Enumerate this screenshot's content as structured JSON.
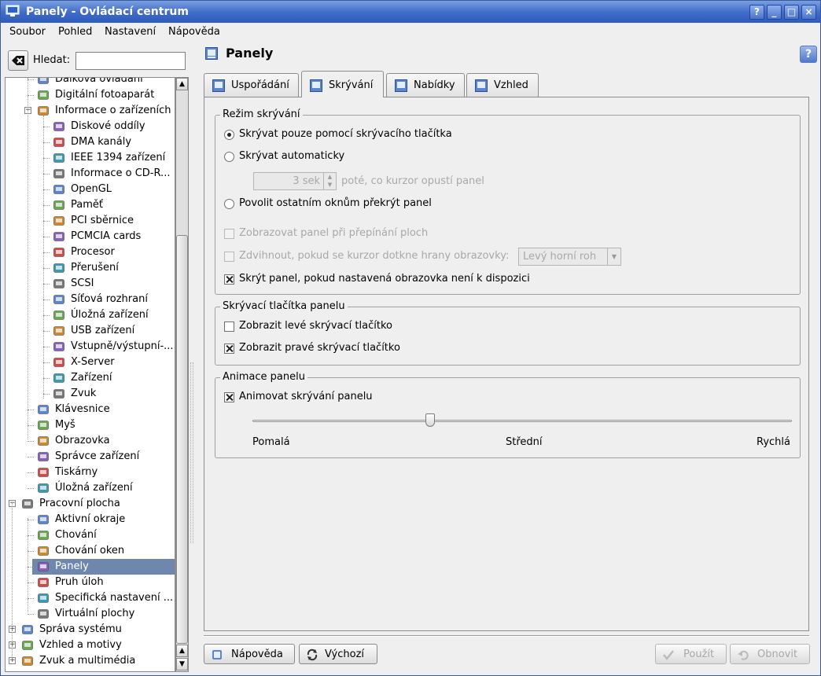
{
  "window": {
    "title": "Panely - Ovládací centrum",
    "buttons": {
      "help": "?",
      "minimize": "_",
      "maximize": "□",
      "close": "×"
    }
  },
  "menubar": [
    "Soubor",
    "Pohled",
    "Nastavení",
    "Nápověda"
  ],
  "search": {
    "label": "Hledat:",
    "value": ""
  },
  "tree": [
    {
      "label": "Dálková ovládání",
      "icon": "remote-icon",
      "level": 1
    },
    {
      "label": "Digitální fotoaparát",
      "icon": "camera-icon",
      "level": 1
    },
    {
      "label": "Informace o zařízeních",
      "icon": "info-icon",
      "level": 1,
      "expanded": true
    },
    {
      "label": "Diskové oddíly",
      "icon": "disk-icon",
      "level": 2
    },
    {
      "label": "DMA kanály",
      "icon": "dma-icon",
      "level": 2
    },
    {
      "label": "IEEE 1394 zařízení",
      "icon": "firewire-icon",
      "level": 2
    },
    {
      "label": "Informace o CD-R...",
      "icon": "cdrom-icon",
      "level": 2
    },
    {
      "label": "OpenGL",
      "icon": "opengl-icon",
      "level": 2
    },
    {
      "label": "Paměť",
      "icon": "memory-icon",
      "level": 2
    },
    {
      "label": "PCI sběrnice",
      "icon": "pci-icon",
      "level": 2
    },
    {
      "label": "PCMCIA cards",
      "icon": "pcmcia-icon",
      "level": 2
    },
    {
      "label": "Procesor",
      "icon": "cpu-icon",
      "level": 2
    },
    {
      "label": "Přerušení",
      "icon": "interrupt-icon",
      "level": 2
    },
    {
      "label": "SCSI",
      "icon": "scsi-icon",
      "level": 2
    },
    {
      "label": "Síťová rozhraní",
      "icon": "network-icon",
      "level": 2
    },
    {
      "label": "Úložná zařízení",
      "icon": "storage-icon",
      "level": 2
    },
    {
      "label": "USB zařízení",
      "icon": "usb-icon",
      "level": 2
    },
    {
      "label": "Vstupně/výstupní-...",
      "icon": "io-icon",
      "level": 2
    },
    {
      "label": "X-Server",
      "icon": "xserver-icon",
      "level": 2
    },
    {
      "label": "Zařízení",
      "icon": "device-icon",
      "level": 2
    },
    {
      "label": "Zvuk",
      "icon": "sound-icon",
      "level": 2
    },
    {
      "label": "Klávesnice",
      "icon": "keyboard-icon",
      "level": 1
    },
    {
      "label": "Myš",
      "icon": "mouse-icon",
      "level": 1
    },
    {
      "label": "Obrazovka",
      "icon": "display-icon",
      "level": 1
    },
    {
      "label": "Správce zařízení",
      "icon": "device-manager-icon",
      "level": 1
    },
    {
      "label": "Tiskárny",
      "icon": "printer-icon",
      "level": 1
    },
    {
      "label": "Úložná zařízení",
      "icon": "storage-icon",
      "level": 1
    },
    {
      "label": "Pracovní plocha",
      "icon": "desktop-icon",
      "level": 0,
      "expanded": true
    },
    {
      "label": "Aktivní okraje",
      "icon": "edges-icon",
      "level": 1
    },
    {
      "label": "Chování",
      "icon": "behavior-icon",
      "level": 1
    },
    {
      "label": "Chování oken",
      "icon": "window-behavior-icon",
      "level": 1
    },
    {
      "label": "Panely",
      "icon": "panel-icon",
      "level": 1,
      "selected": true
    },
    {
      "label": "Pruh úloh",
      "icon": "taskbar-icon",
      "level": 1
    },
    {
      "label": "Specifická nastavení ...",
      "icon": "window-specific-icon",
      "level": 1
    },
    {
      "label": "Virtuální plochy",
      "icon": "virtual-desktops-icon",
      "level": 1
    },
    {
      "label": "Správa systému",
      "icon": "system-admin-icon",
      "level": 0,
      "expanded": false
    },
    {
      "label": "Vzhled a motivy",
      "icon": "appearance-icon",
      "level": 0,
      "expanded": false
    },
    {
      "label": "Zvuk a multimédia",
      "icon": "multimedia-icon",
      "level": 0,
      "expanded": false
    }
  ],
  "page": {
    "title": "Panely"
  },
  "tabs": [
    {
      "label": "Uspořádání",
      "active": false
    },
    {
      "label": "Skrývání",
      "active": true
    },
    {
      "label": "Nabídky",
      "active": false
    },
    {
      "label": "Vzhled",
      "active": false
    }
  ],
  "hide_mode": {
    "title": "Režim skrývání",
    "manual": "Skrývat pouze pomocí skrývacího tlačítka",
    "automatic": "Skrývat automaticky",
    "delay_value": "3 sek",
    "delay_after": "poté, co kurzor opustí panel",
    "allow_cover": "Povolit ostatním oknům překrýt panel",
    "selected": "manual",
    "show_on_switch": "Zobrazovat panel při přepínání ploch",
    "raise_on_edge": "Zdvihnout, pokud se kurzor dotkne hrany obrazovky:",
    "corner_value": "Levý horní roh",
    "hide_unavailable": "Skrýt panel, pokud nastavená obrazovka není k dispozici"
  },
  "hide_buttons": {
    "title": "Skrývací tlačítka panelu",
    "left": "Zobrazit levé skrývací tlačítko",
    "right": "Zobrazit pravé skrývací tlačítko"
  },
  "animation": {
    "title": "Animace panelu",
    "animate": "Animovat skrývání panelu",
    "speed_fraction": 0.33,
    "slow": "Pomalá",
    "medium": "Střední",
    "fast": "Rychlá"
  },
  "buttons": {
    "help": "Nápověda",
    "defaults": "Výchozí",
    "apply": "Použít",
    "reset": "Obnovit"
  }
}
